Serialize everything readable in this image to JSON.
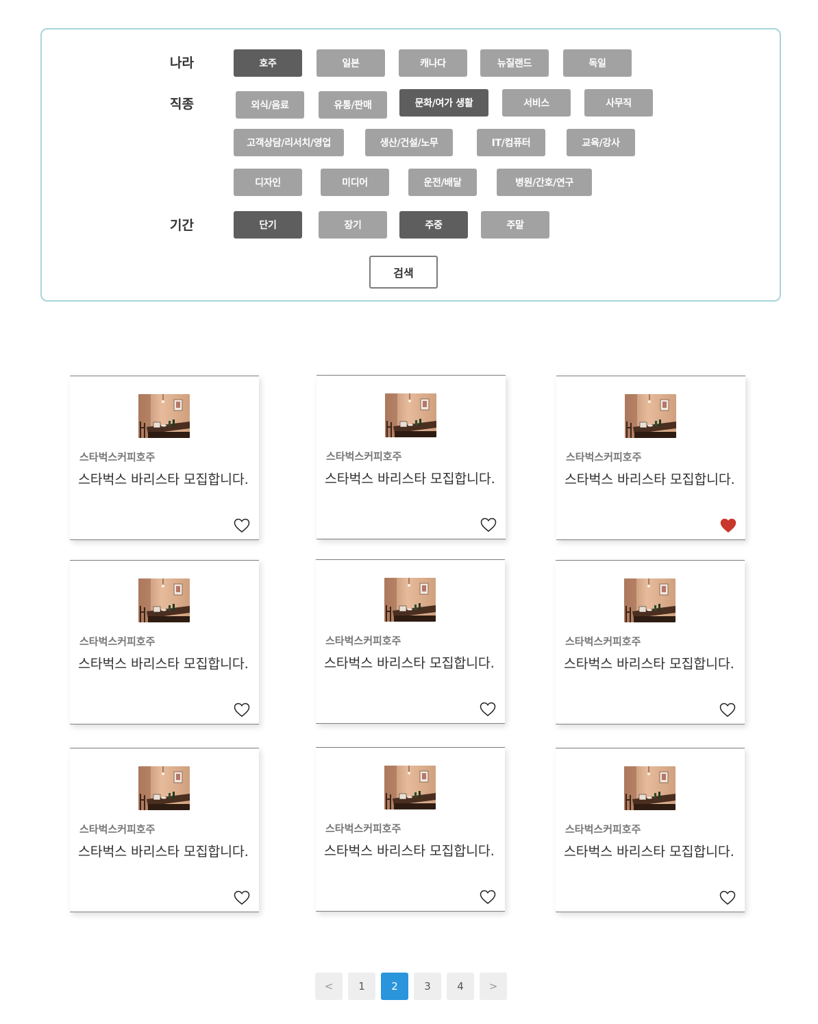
{
  "filters": {
    "country": {
      "label": "나라",
      "options": [
        {
          "label": "호주",
          "active": true
        },
        {
          "label": "일본",
          "active": false
        },
        {
          "label": "캐나다",
          "active": false
        },
        {
          "label": "뉴질랜드",
          "active": false
        },
        {
          "label": "독일",
          "active": false
        }
      ]
    },
    "job": {
      "label": "직종",
      "options": [
        {
          "label": "외식/음료",
          "active": false
        },
        {
          "label": "유통/판매",
          "active": false
        },
        {
          "label": "문화/여가 생활",
          "active": true
        },
        {
          "label": "서비스",
          "active": false
        },
        {
          "label": "사무직",
          "active": false
        },
        {
          "label": "고객상담/리서치/영업",
          "active": false
        },
        {
          "label": "생산/건설/노무",
          "active": false
        },
        {
          "label": "IT/컴퓨터",
          "active": false
        },
        {
          "label": "교육/강사",
          "active": false
        },
        {
          "label": "디자인",
          "active": false
        },
        {
          "label": "미디어",
          "active": false
        },
        {
          "label": "운전/배달",
          "active": false
        },
        {
          "label": "병원/간호/연구",
          "active": false
        }
      ]
    },
    "period": {
      "label": "기간",
      "options": [
        {
          "label": "단기",
          "active": true
        },
        {
          "label": "장기",
          "active": false
        },
        {
          "label": "주중",
          "active": true
        },
        {
          "label": "주말",
          "active": false
        }
      ]
    },
    "search_label": "검색"
  },
  "listings": [
    {
      "company": "스타벅스커피호주",
      "title": "스타벅스 바리스타 모집합니다.",
      "liked": false
    },
    {
      "company": "스타벅스커피호주",
      "title": "스타벅스 바리스타 모집합니다.",
      "liked": false
    },
    {
      "company": "스타벅스커피호주",
      "title": "스타벅스 바리스타 모집합니다.",
      "liked": true
    },
    {
      "company": "스타벅스커피호주",
      "title": "스타벅스 바리스타 모집합니다.",
      "liked": false
    },
    {
      "company": "스타벅스커피호주",
      "title": "스타벅스 바리스타 모집합니다.",
      "liked": false
    },
    {
      "company": "스타벅스커피호주",
      "title": "스타벅스 바리스타 모집합니다.",
      "liked": false
    },
    {
      "company": "스타벅스커피호주",
      "title": "스타벅스 바리스타 모집합니다.",
      "liked": false
    },
    {
      "company": "스타벅스커피호주",
      "title": "스타벅스 바리스타 모집합니다.",
      "liked": false
    },
    {
      "company": "스타벅스커피호주",
      "title": "스타벅스 바리스타 모집합니다.",
      "liked": false
    }
  ],
  "pagination": {
    "prev": "<",
    "pages": [
      "1",
      "2",
      "3",
      "4"
    ],
    "current": "2",
    "next": ">"
  },
  "colors": {
    "chip_inactive": "#a2a2a2",
    "chip_active": "#5e5e5e",
    "panel_border": "#a8d4da",
    "heart_liked": "#c9372c",
    "page_current": "#2b95dc"
  }
}
